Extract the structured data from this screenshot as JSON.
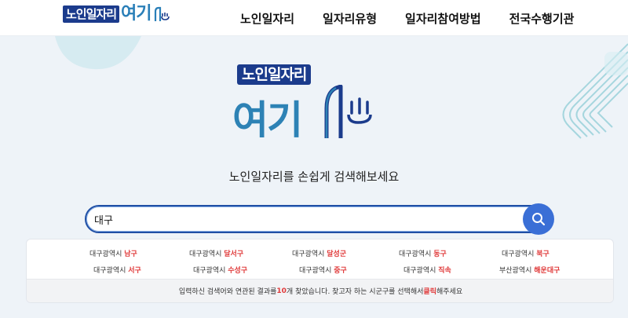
{
  "header": {
    "logo_small": "노인일자리",
    "logo_big": "여기",
    "nav": [
      "노인일자리",
      "일자리유형",
      "일자리참여방법",
      "전국수행기관"
    ]
  },
  "hero": {
    "logo_top": "노인일자리",
    "logo_main": "여기",
    "tagline": "노인일자리를 손쉽게 검색해보세요"
  },
  "search": {
    "value": "대구",
    "icon": "search-icon"
  },
  "results": {
    "items": [
      {
        "city": "대구광역시",
        "district": "남구"
      },
      {
        "city": "대구광역시",
        "district": "달서구"
      },
      {
        "city": "대구광역시",
        "district": "달성군"
      },
      {
        "city": "대구광역시",
        "district": "동구"
      },
      {
        "city": "대구광역시",
        "district": "북구"
      },
      {
        "city": "대구광역시",
        "district": "서구"
      },
      {
        "city": "대구광역시",
        "district": "수성구"
      },
      {
        "city": "대구광역시",
        "district": "중구"
      },
      {
        "city": "대구광역시",
        "district": "직속"
      },
      {
        "city": "부산광역시",
        "district": "해운대구"
      }
    ],
    "footer_pre": "입력하신 검색어와 연관된 결과를 ",
    "footer_count": "10",
    "footer_mid": "개 찾았습니다. 찾고자 하는 시군구를 선택해서 ",
    "footer_click": "클릭",
    "footer_post": "해주세요"
  },
  "colors": {
    "brand_navy": "#1b3b8c",
    "brand_blue": "#2d82b5",
    "search_button": "#3a6fd6",
    "highlight_red": "#e03a3a"
  }
}
